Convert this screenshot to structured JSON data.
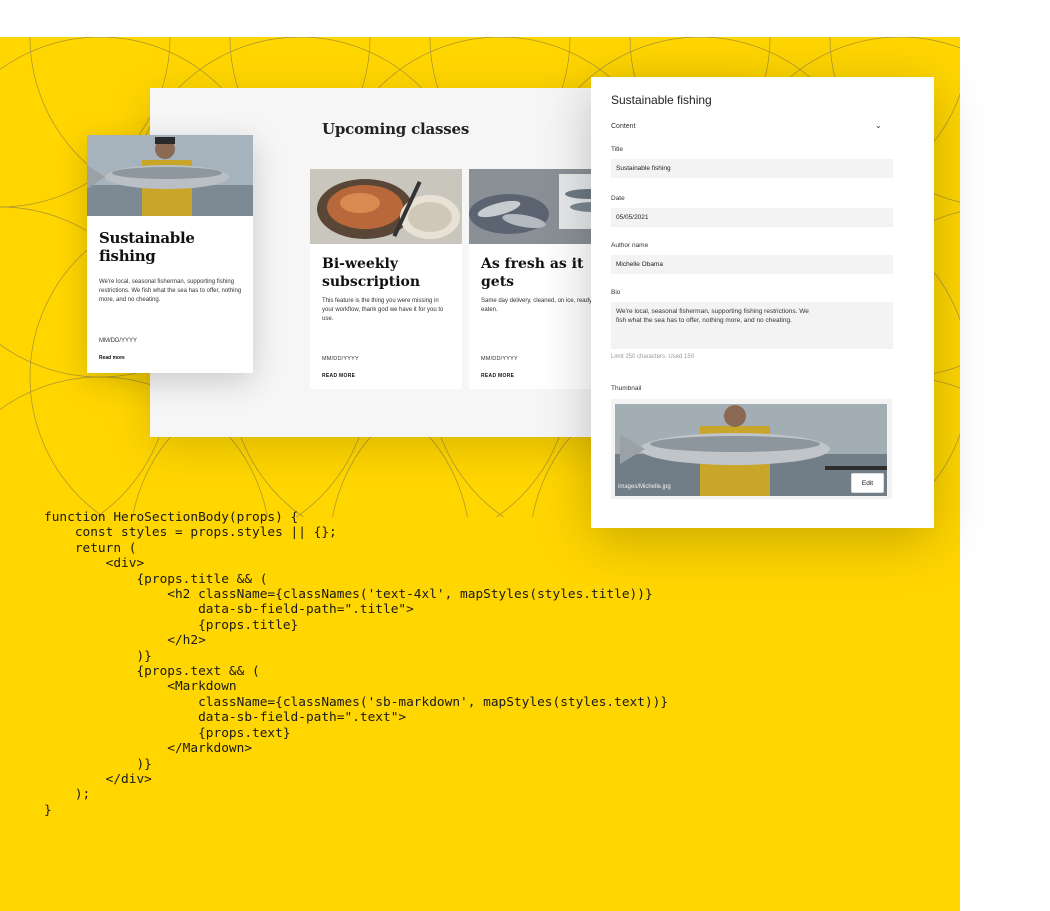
{
  "canvas": {
    "heading": "Upcoming classes",
    "main_card": {
      "title": "Sustainable fishing",
      "description": "We're local, seasonal fisherman, supporting fishing restrictions. We fish what the sea has to offer, nothing more, and no cheating.",
      "date": "MM/DD/YYYY",
      "read_more": "Read more"
    },
    "cards": [
      {
        "title": "Bi-weekly subscription",
        "description": "This feature is the thing you were missing in your workflow, thank god we have it for you to use.",
        "date": "MM/DD/YYYY",
        "read_more": "READ MORE"
      },
      {
        "title": "As fresh as it gets",
        "description": "Same day delivery, cleaned, on ice, ready to be eaten.",
        "date": "MM/DD/YYYY",
        "read_more": "READ MORE"
      }
    ]
  },
  "editor": {
    "title": "Sustainable fishing",
    "section": "Content",
    "fields": {
      "title_label": "Title",
      "title_value": "Sustainable fishing",
      "date_label": "Date",
      "date_value": "05/05/2021",
      "author_label": "Author name",
      "author_value": "Michelle Obama",
      "bio_label": "Bio",
      "bio_value": "We're local, seasonal fisherman, supporting fishing restrictions. We fish what the sea has to offer, nothing more, and no cheating.",
      "bio_hint": "Limit 250 characters. Used 150",
      "thumbnail_label": "Thumbnail",
      "thumbnail_path": "images/Michelle.jpg",
      "edit_button": "Edit"
    }
  },
  "code": {
    "text": "function HeroSectionBody(props) {\n    const styles = props.styles || {};\n    return (\n        <div>\n            {props.title && (\n                <h2 className={classNames('text-4xl', mapStyles(styles.title))}\n                    data-sb-field-path=\".title\">\n                    {props.title}\n                </h2>\n            )}\n            {props.text && (\n                <Markdown\n                    className={classNames('sb-markdown', mapStyles(styles.text))}\n                    data-sb-field-path=\".text\">\n                    {props.text}\n                </Markdown>\n            )}\n        </div>\n    );\n}"
  },
  "colors": {
    "background_accent": "#ffd600",
    "line_pattern": "#7a6a3a"
  }
}
